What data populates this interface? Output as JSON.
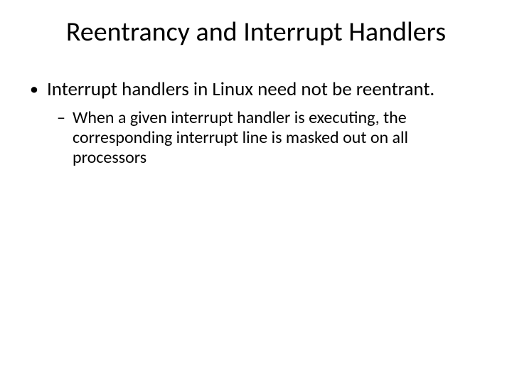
{
  "slide": {
    "title": "Reentrancy and Interrupt Handlers",
    "bullets": [
      {
        "marker": "•",
        "text": "Interrupt handlers in Linux need not be reentrant.",
        "sub": [
          {
            "marker": "–",
            "text": "When a given interrupt handler is executing, the corresponding interrupt line is masked out on all processors"
          }
        ]
      }
    ]
  }
}
